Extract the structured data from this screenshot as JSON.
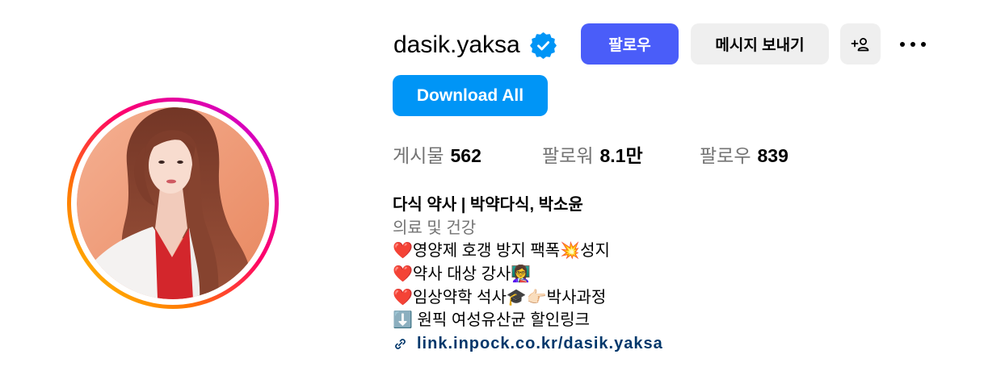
{
  "profile": {
    "username": "dasik.yaksa",
    "verified": true,
    "verified_icon": "verified-badge-icon",
    "avatar_icon": "profile-photo"
  },
  "actions": {
    "follow_label": "팔로우",
    "message_label": "메시지 보내기",
    "suggest_icon": "add-person-icon",
    "more_icon": "more-options-icon",
    "download_all_label": "Download All"
  },
  "stats": [
    {
      "label": "게시물",
      "value": "562"
    },
    {
      "label": "팔로워",
      "value": "8.1만"
    },
    {
      "label": "팔로우",
      "value": "839"
    }
  ],
  "bio": {
    "full_name": "다식 약사 | 박약다식, 박소윤",
    "category": "의료 및 건강",
    "lines": [
      "❤️영양제 호갱 방지 팩폭💥성지",
      "❤️약사 대상 강사👩‍🏫",
      "❤️임상약학 석사🎓👉🏻박사과정",
      "⬇️ 원픽 여성유산균 할인링크"
    ],
    "link_icon": "link-icon",
    "link_text": "link.inpock.co.kr/dasik.yaksa"
  },
  "colors": {
    "follow_button": "#4a5df9",
    "download_button": "#0095f6",
    "secondary_button": "#efefef",
    "verified_badge": "#0095f6",
    "link": "#00376b",
    "muted_text": "#737373",
    "story_ring": [
      "#ffd600",
      "#ff7a00",
      "#ff0069",
      "#d300c5"
    ]
  }
}
